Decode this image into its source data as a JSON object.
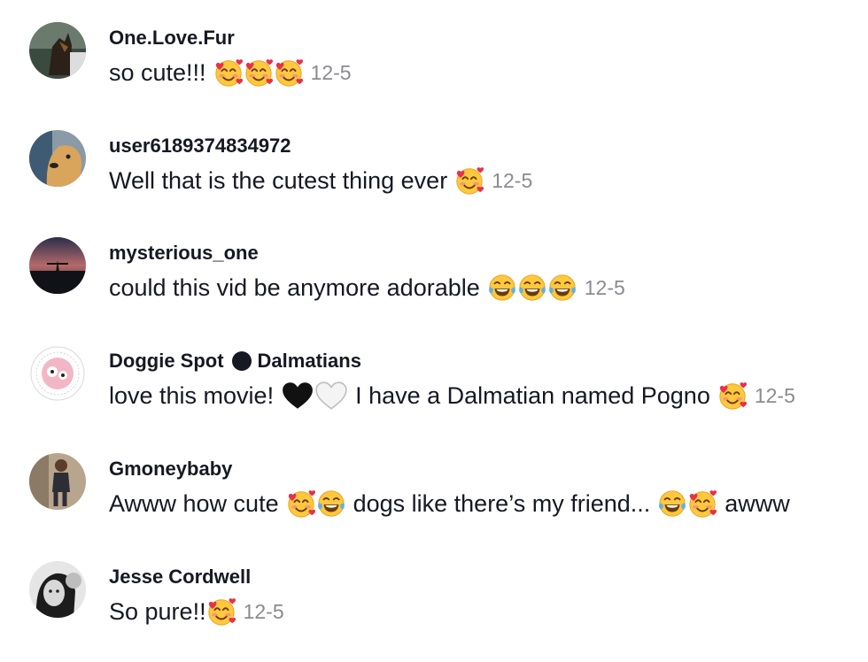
{
  "comments": [
    {
      "username": "One.Love.Fur",
      "text": "so cute!!!",
      "date": "12-5"
    },
    {
      "username": "user6189374834972",
      "text": "Well that is the cutest thing ever",
      "date": "12-5"
    },
    {
      "username": "mysterious_one",
      "text": "could this vid be anymore adorable",
      "date": "12-5"
    },
    {
      "username_part1": "Doggie Spot",
      "username_part2": "Dalmatians",
      "text_part1": "love this movie!",
      "text_part2": "I have a Dalmatian named Pogno",
      "date": "12-5"
    },
    {
      "username": "Gmoneybaby",
      "text_part1": "Awww how cute",
      "text_part2": "dogs like there’s my friend...",
      "text_part3": "awww"
    },
    {
      "username": "Jesse Cordwell",
      "text": "So pure!!",
      "date": "12-5"
    }
  ],
  "icons": {
    "hearts_face": "smiling-face-with-hearts-icon",
    "tears_of_joy": "face-with-tears-of-joy-icon",
    "black_heart": "black-heart-icon",
    "white_heart": "white-heart-icon"
  },
  "colors": {
    "text": "#161823",
    "date": "#8a8b91"
  }
}
